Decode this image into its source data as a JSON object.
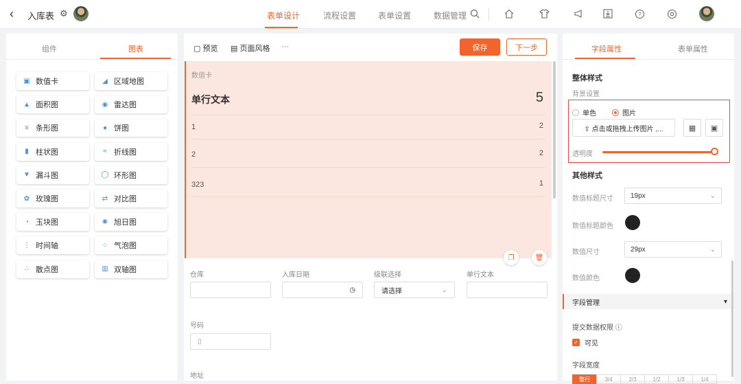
{
  "header": {
    "back_icon": "chevron-left-icon",
    "title": "入库表",
    "nav": [
      "表单设计",
      "流程设置",
      "表单设置",
      "数据管理"
    ],
    "active_nav": "表单设计",
    "icons": [
      "search-icon",
      "home-icon",
      "shirt-icon",
      "megaphone-icon",
      "download-icon",
      "help-icon",
      "settings-icon"
    ],
    "accent": "#f2642d"
  },
  "left": {
    "tabs": [
      "组件",
      "图表"
    ],
    "active_tab": "图表",
    "components": [
      {
        "label": "数值卡",
        "icon": "number-card-icon"
      },
      {
        "label": "区域地图",
        "icon": "area-map-icon"
      },
      {
        "label": "面积图",
        "icon": "area-chart-icon"
      },
      {
        "label": "雷达图",
        "icon": "radar-chart-icon"
      },
      {
        "label": "条形图",
        "icon": "bar-chart-icon"
      },
      {
        "label": "饼图",
        "icon": "pie-chart-icon"
      },
      {
        "label": "柱状图",
        "icon": "column-chart-icon"
      },
      {
        "label": "折线图",
        "icon": "line-chart-icon"
      },
      {
        "label": "漏斗图",
        "icon": "funnel-chart-icon"
      },
      {
        "label": "环形图",
        "icon": "donut-chart-icon"
      },
      {
        "label": "玫瑰图",
        "icon": "rose-chart-icon"
      },
      {
        "label": "对比图",
        "icon": "compare-chart-icon"
      },
      {
        "label": "玉块图",
        "icon": "jade-chart-icon"
      },
      {
        "label": "旭日图",
        "icon": "sunburst-chart-icon"
      },
      {
        "label": "时间轴",
        "icon": "timeline-icon"
      },
      {
        "label": "气泡图",
        "icon": "bubble-chart-icon"
      },
      {
        "label": "散点图",
        "icon": "scatter-chart-icon"
      },
      {
        "label": "双轴图",
        "icon": "dual-axis-chart-icon"
      }
    ]
  },
  "center": {
    "toolbar": {
      "preview": "预览",
      "page_style": "页面风格",
      "more": "···",
      "save": "保存",
      "next": "下一步"
    },
    "card": {
      "label": "数值卡",
      "title": "单行文本",
      "count": "5",
      "rows": [
        {
          "name": "1",
          "value": "2"
        },
        {
          "name": "2",
          "value": "2"
        },
        {
          "name": "323",
          "value": "1"
        }
      ]
    },
    "fields": {
      "warehouse": "仓库",
      "inbound_date": "入库日期",
      "cascade": "级联选择",
      "cascade_placeholder": "请选择",
      "single_text": "单行文本",
      "number": "号码",
      "address": "地址"
    }
  },
  "right": {
    "tabs": [
      "字段属性",
      "表单属性"
    ],
    "active_tab": "字段属性",
    "overall_style": "整体样式",
    "bg_setting": "背景设置",
    "bg_options": [
      "单色",
      "图片"
    ],
    "bg_selected": "图片",
    "upload_text": "⇧ 点击或拖拽上传图片 ,...",
    "opacity_label": "透明度",
    "opacity_value": 1.0,
    "other_style": "其他样式",
    "value_title_size_label": "数值标题尺寸",
    "value_title_size": "19px",
    "value_title_color_label": "数值标题颜色",
    "value_title_color": "#222222",
    "value_size_label": "数值尺寸",
    "value_size": "29px",
    "value_color_label": "数值颜色",
    "value_color": "#222222",
    "field_manage": "字段管理",
    "submit_perm": "提交数据权限",
    "visible": "可见",
    "field_width": "字段宽度",
    "width_options": [
      "整行",
      "3/4",
      "2/3",
      "1/2",
      "1/3",
      "1/4"
    ]
  }
}
